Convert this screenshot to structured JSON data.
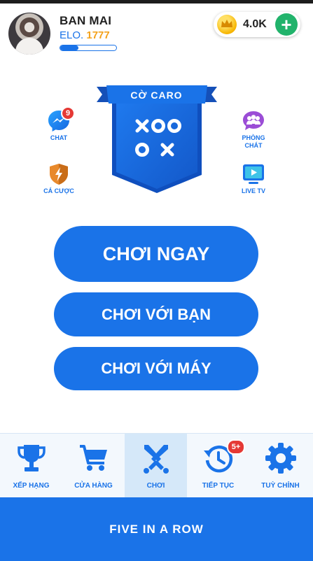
{
  "player": {
    "name": "BAN MAI",
    "elo_label": "ELO.",
    "elo_value": "1777",
    "xp_progress": 0.33
  },
  "wallet": {
    "coins": "4.0K",
    "add_label": "+"
  },
  "banner": {
    "title": "CỜ CARO",
    "logo_text": [
      "X",
      "O",
      "O",
      "O",
      "X"
    ]
  },
  "side_left": [
    {
      "label": "CHAT",
      "badge": "9"
    },
    {
      "label": "CÁ CƯỢC"
    }
  ],
  "side_right": [
    {
      "label_line1": "PHÒNG",
      "label_line2": "CHÁT"
    },
    {
      "label": "LIVE TV"
    }
  ],
  "buttons": {
    "play_now": "CHƠI NGAY",
    "play_friend": "CHƠI VỚI BẠN",
    "play_bot": "CHƠI VỚI MÁY"
  },
  "nav": [
    {
      "label": "XẾP HẠNG",
      "icon": "trophy-icon"
    },
    {
      "label": "CỬA HÀNG",
      "icon": "cart-icon"
    },
    {
      "label": "CHƠI",
      "icon": "swords-icon",
      "active": true
    },
    {
      "label": "TIẾP TỤC",
      "icon": "history-icon",
      "badge": "5+"
    },
    {
      "label": "TUỲ CHỈNH",
      "icon": "gear-icon"
    }
  ],
  "footer": {
    "title": "FIVE IN A ROW"
  },
  "colors": {
    "primary": "#1a73e8",
    "accent_gold": "#f4a21b",
    "add_green": "#21b36b",
    "badge_red": "#e53935"
  }
}
